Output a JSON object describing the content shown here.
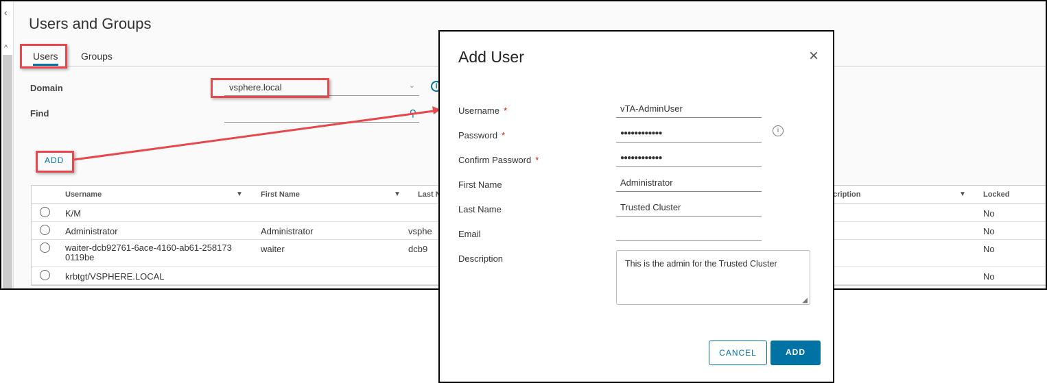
{
  "page": {
    "title": "Users and Groups",
    "tabs": [
      {
        "label": "Users",
        "active": true
      },
      {
        "label": "Groups",
        "active": false
      }
    ],
    "domain_label": "Domain",
    "domain_value": "vsphere.local",
    "find_label": "Find",
    "find_value": "",
    "add_label": "ADD"
  },
  "table": {
    "columns": [
      "Username",
      "First Name",
      "Last N",
      "scription",
      "Locked"
    ],
    "rows": [
      {
        "username": "K/M",
        "first": "",
        "last": "",
        "locked": "No"
      },
      {
        "username": "Administrator",
        "first": "Administrator",
        "last": "vsphe",
        "locked": "No"
      },
      {
        "username": "waiter-dcb92761-6ace-4160-ab61-258173 0119be",
        "first": "waiter",
        "last": "dcb9",
        "locked": "No"
      },
      {
        "username": "krbtgt/VSPHERE.LOCAL",
        "first": "",
        "last": "",
        "locked": "No"
      }
    ]
  },
  "dialog": {
    "title": "Add User",
    "fields": [
      {
        "label": "Username",
        "required": true,
        "value": "vTA-AdminUser"
      },
      {
        "label": "Password",
        "required": true,
        "value": "●●●●●●●●●●●●"
      },
      {
        "label": "Confirm Password",
        "required": true,
        "value": "●●●●●●●●●●●●"
      },
      {
        "label": "First Name",
        "required": false,
        "value": "Administrator"
      },
      {
        "label": "Last Name",
        "required": false,
        "value": "Trusted Cluster"
      },
      {
        "label": "Email",
        "required": false,
        "value": ""
      }
    ],
    "description_label": "Description",
    "description_value": "This is the admin for the Trusted Cluster",
    "cancel_label": "CANCEL",
    "add_label": "ADD",
    "required_mark": "*"
  },
  "colors": {
    "accent": "#0072a3",
    "highlight": "#e8474c"
  }
}
